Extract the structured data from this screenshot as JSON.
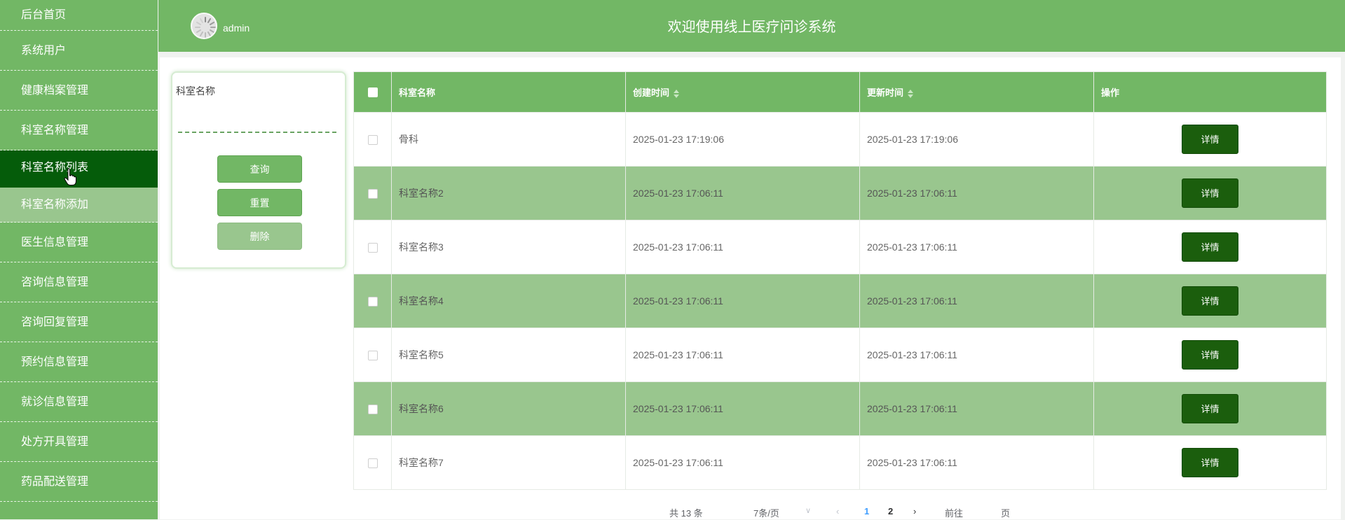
{
  "sidebar": {
    "items": [
      {
        "label": "后台首页"
      },
      {
        "label": "系统用户"
      },
      {
        "label": "健康档案管理"
      },
      {
        "label": "科室名称管理"
      },
      {
        "label": "科室名称列表"
      },
      {
        "label": "科室名称添加"
      },
      {
        "label": "医生信息管理"
      },
      {
        "label": "咨询信息管理"
      },
      {
        "label": "咨询回复管理"
      },
      {
        "label": "预约信息管理"
      },
      {
        "label": "就诊信息管理"
      },
      {
        "label": "处方开具管理"
      },
      {
        "label": "药品配送管理"
      }
    ]
  },
  "header": {
    "user": "admin",
    "title": "欢迎使用线上医疗问诊系统"
  },
  "search": {
    "label": "科室名称",
    "value": "",
    "query_label": "查询",
    "reset_label": "重置",
    "delete_label": "删除"
  },
  "table": {
    "columns": {
      "name": "科室名称",
      "created": "创建时间",
      "updated": "更新时间",
      "action": "操作"
    },
    "detail_label": "详情",
    "rows": [
      {
        "name": "骨科",
        "created": "2025-01-23 17:19:06",
        "updated": "2025-01-23 17:19:06"
      },
      {
        "name": "科室名称2",
        "created": "2025-01-23 17:06:11",
        "updated": "2025-01-23 17:06:11"
      },
      {
        "name": "科室名称3",
        "created": "2025-01-23 17:06:11",
        "updated": "2025-01-23 17:06:11"
      },
      {
        "name": "科室名称4",
        "created": "2025-01-23 17:06:11",
        "updated": "2025-01-23 17:06:11"
      },
      {
        "name": "科室名称5",
        "created": "2025-01-23 17:06:11",
        "updated": "2025-01-23 17:06:11"
      },
      {
        "name": "科室名称6",
        "created": "2025-01-23 17:06:11",
        "updated": "2025-01-23 17:06:11"
      },
      {
        "name": "科室名称7",
        "created": "2025-01-23 17:06:11",
        "updated": "2025-01-23 17:06:11"
      }
    ]
  },
  "pagination": {
    "total": "共 13 条",
    "page_size": "7条/页",
    "pages": [
      "1",
      "2"
    ],
    "current": "1",
    "goto": "前往",
    "page_suffix": "页"
  },
  "colors": {
    "primary": "#72b765",
    "active": "#055c0a",
    "alt_row": "#99c68e",
    "detail_button": "#1b5e0d"
  }
}
